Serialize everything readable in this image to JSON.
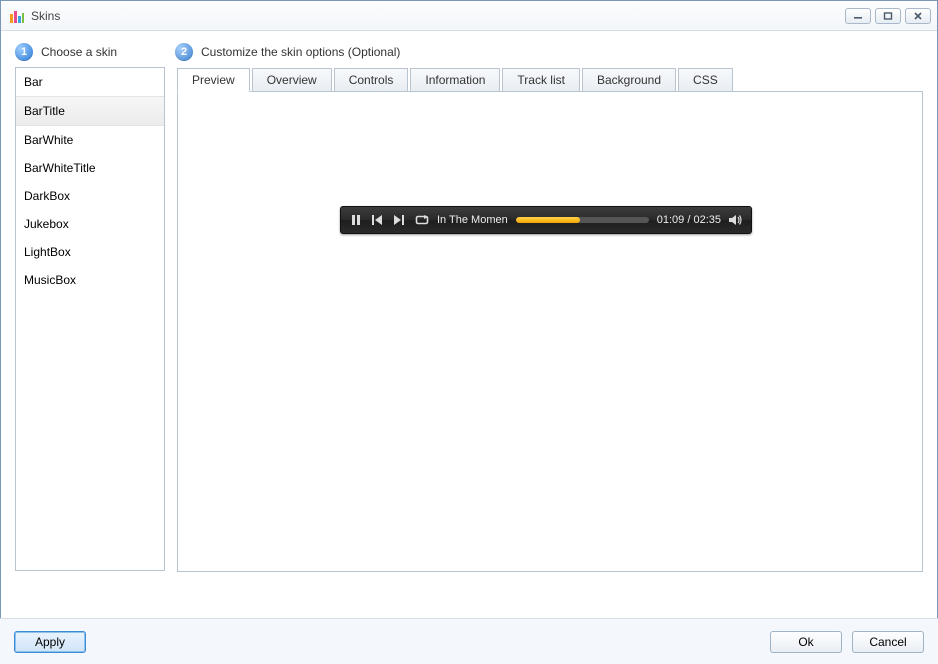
{
  "window": {
    "title": "Skins"
  },
  "steps": {
    "one": {
      "num": "1",
      "label": "Choose a skin"
    },
    "two": {
      "num": "2",
      "label": "Customize the skin options (Optional)"
    }
  },
  "skins": {
    "items": [
      "Bar",
      "BarTitle",
      "BarWhite",
      "BarWhiteTitle",
      "DarkBox",
      "Jukebox",
      "LightBox",
      "MusicBox"
    ],
    "selected_index": 1
  },
  "tabs": {
    "items": [
      "Preview",
      "Overview",
      "Controls",
      "Information",
      "Track list",
      "Background",
      "CSS"
    ],
    "active_index": 0
  },
  "player": {
    "track_title": "In The Momen",
    "time": "01:09 / 02:35",
    "progress_percent": 48,
    "icons": {
      "pause": "pause-icon",
      "prev": "prev-icon",
      "next": "next-icon",
      "repeat": "repeat-icon",
      "volume": "volume-icon"
    }
  },
  "buttons": {
    "apply": "Apply",
    "ok": "Ok",
    "cancel": "Cancel"
  },
  "colors": {
    "accent": "#2a7ad6",
    "progress": "#f5a500"
  }
}
